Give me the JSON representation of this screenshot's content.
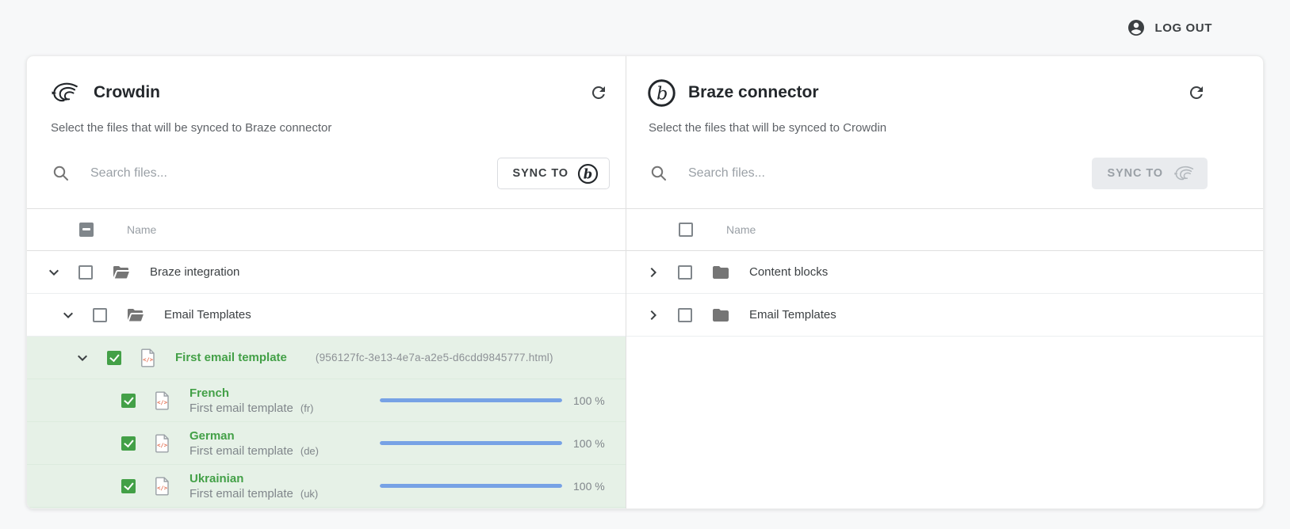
{
  "page": {
    "logout_label": "LOG OUT"
  },
  "left_panel": {
    "title": "Crowdin",
    "subtitle": "Select the files that will be synced to Braze connector",
    "search_placeholder": "Search files...",
    "sync_button_label": "SYNC TO",
    "name_column": "Name",
    "header_checkbox_state": "indeterminate",
    "rows": [
      {
        "name": "Braze integration",
        "type": "folder",
        "expanded": true,
        "checked": false
      },
      {
        "name": "Email Templates",
        "type": "folder",
        "expanded": true,
        "checked": false
      },
      {
        "name": "First email template",
        "type": "html-file",
        "expanded": true,
        "checked": true,
        "file_id": "(956127fc-3e13-4e7a-a2e5-d6cdd9845777.html)"
      },
      {
        "language": "French",
        "name": "First email template",
        "language_code": "(fr)",
        "type": "html-file",
        "checked": true,
        "progress_percent": 100,
        "progress_label": "100 %"
      },
      {
        "language": "German",
        "name": "First email template",
        "language_code": "(de)",
        "type": "html-file",
        "checked": true,
        "progress_percent": 100,
        "progress_label": "100 %"
      },
      {
        "language": "Ukrainian",
        "name": "First email template",
        "language_code": "(uk)",
        "type": "html-file",
        "checked": true,
        "progress_percent": 100,
        "progress_label": "100 %"
      }
    ]
  },
  "right_panel": {
    "title": "Braze connector",
    "subtitle": "Select the files that will be synced to Crowdin",
    "search_placeholder": "Search files...",
    "sync_button_label": "SYNC TO",
    "sync_button_disabled": true,
    "name_column": "Name",
    "header_checkbox_state": "unchecked",
    "rows": [
      {
        "name": "Content blocks",
        "type": "folder",
        "expanded": false,
        "checked": false
      },
      {
        "name": "Email Templates",
        "type": "folder",
        "expanded": false,
        "checked": false
      }
    ]
  },
  "colors": {
    "accent_green": "#43a047",
    "selected_row_bg": "#e6f1e7",
    "progress_blue": "#77a2e5",
    "brand_dark": "#23272b",
    "muted_text": "#80868b"
  },
  "icons": {
    "logout": "account-circle-icon",
    "panel_refresh": "refresh-icon",
    "search": "search-icon",
    "left_logo": "crowdin-icon",
    "right_logo": "braze-icon",
    "sync_left_target": "braze-icon",
    "sync_right_target": "crowdin-icon",
    "folder_expanded": "folder-open-icon",
    "folder_collapsed": "folder-icon",
    "file": "html-file-icon"
  }
}
